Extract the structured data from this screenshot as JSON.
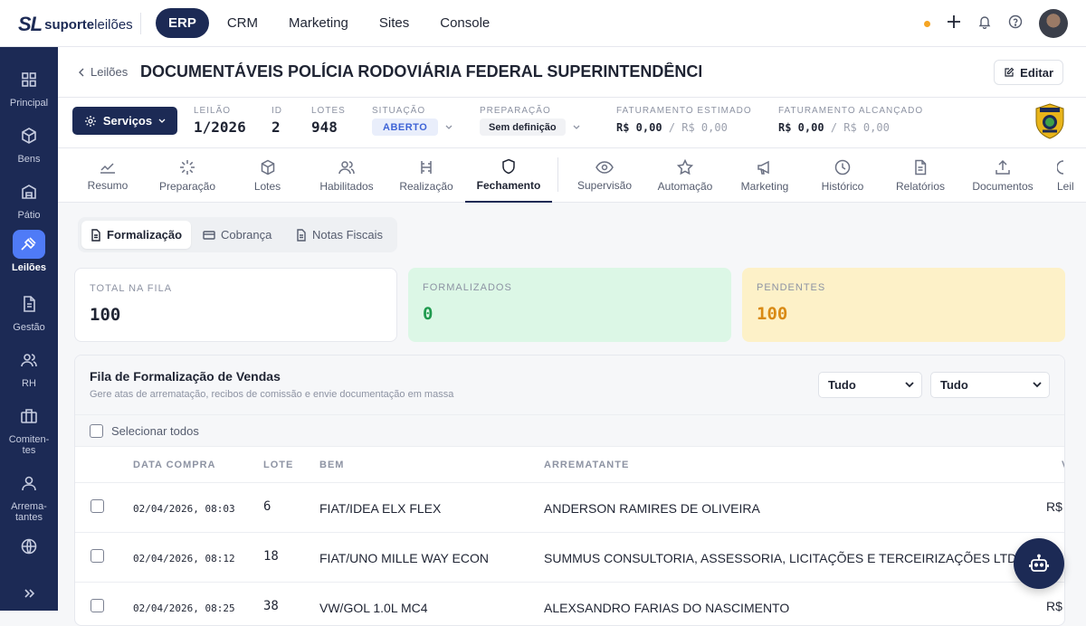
{
  "brand": {
    "mark": "SL",
    "word_bold": "suporte",
    "word_light": "leilões"
  },
  "topnav": [
    {
      "label": "ERP",
      "active": true
    },
    {
      "label": "CRM",
      "active": false
    },
    {
      "label": "Marketing",
      "active": false
    },
    {
      "label": "Sites",
      "active": false
    },
    {
      "label": "Console",
      "active": false
    }
  ],
  "sidebar": [
    {
      "label": "Principal",
      "icon": "grid-icon"
    },
    {
      "label": "Bens",
      "icon": "box-icon"
    },
    {
      "label": "Pátio",
      "icon": "warehouse-icon"
    },
    {
      "label": "Leilões",
      "icon": "gavel-icon",
      "active": true
    },
    {
      "label": "Gestão",
      "icon": "document-icon"
    },
    {
      "label": "RH",
      "icon": "users-icon"
    },
    {
      "label": "Comiten-\ntes",
      "icon": "briefcase-icon"
    },
    {
      "label": "Arrema-\ntantes",
      "icon": "user-icon"
    },
    {
      "label": "",
      "icon": "globe-icon"
    }
  ],
  "header": {
    "back_label": "Leilões",
    "title": "DOCUMENTÁVEIS POLÍCIA RODOVIÁRIA FEDERAL SUPERINTENDÊNCI...",
    "edit_label": "Editar"
  },
  "info": {
    "services_label": "Serviços",
    "leilao_label": "LEILÃO",
    "leilao_value": "1/2026",
    "id_label": "ID",
    "id_value": "2",
    "lotes_label": "LOTES",
    "lotes_value": "948",
    "situacao_label": "SITUAÇÃO",
    "situacao_value": "ABERTO",
    "preparacao_label": "PREPARAÇÃO",
    "preparacao_value": "Sem definição",
    "fat_est_label": "FATURAMENTO ESTIMADO",
    "fat_est_value": "R$ 0,00",
    "fat_est_total": "/ R$ 0,00",
    "fat_alc_label": "FATURAMENTO ALCANÇADO",
    "fat_alc_value": "R$ 0,00",
    "fat_alc_total": "/ R$ 0,00"
  },
  "tabs": [
    {
      "label": "Resumo",
      "icon": "chart-icon"
    },
    {
      "label": "Preparação",
      "icon": "loader-icon"
    },
    {
      "label": "Lotes",
      "icon": "cube-icon"
    },
    {
      "label": "Habilitados",
      "icon": "users-icon"
    },
    {
      "label": "Realização",
      "icon": "gavel-icon"
    },
    {
      "label": "Fechamento",
      "icon": "shield-icon",
      "active": true
    },
    {
      "label": "Supervisão",
      "icon": "eye-icon"
    },
    {
      "label": "Automação",
      "icon": "star-icon"
    },
    {
      "label": "Marketing",
      "icon": "megaphone-icon"
    },
    {
      "label": "Histórico",
      "icon": "clock-icon"
    },
    {
      "label": "Relatórios",
      "icon": "file-icon"
    },
    {
      "label": "Documentos",
      "icon": "upload-icon"
    },
    {
      "label": "Leil",
      "icon": "partial-icon"
    }
  ],
  "subtabs": [
    {
      "label": "Formalização",
      "active": true
    },
    {
      "label": "Cobrança"
    },
    {
      "label": "Notas Fiscais"
    }
  ],
  "stats": [
    {
      "label": "TOTAL NA FILA",
      "value": "100",
      "bg": "#ffffff",
      "color": "#1f2433"
    },
    {
      "label": "FORMALIZADOS",
      "value": "0",
      "bg": "#dcf7e6",
      "color": "#1f9a4e"
    },
    {
      "label": "PENDENTES",
      "value": "100",
      "bg": "#fdf1c8",
      "color": "#d98a14"
    }
  ],
  "queue": {
    "title": "Fila de Formalização de Vendas",
    "subtitle": "Gere atas de arrematação, recibos de comissão e envie documentação em massa",
    "filter1": "Tudo",
    "filter2": "Tudo",
    "select_all": "Selecionar todos",
    "columns": [
      "DATA COMPRA",
      "LOTE",
      "BEM",
      "ARREMATANTE",
      "V"
    ],
    "rows": [
      {
        "date": "02/04/2026, 08:03",
        "lote": "6",
        "bem": "FIAT/IDEA ELX FLEX",
        "arrematante": "ANDERSON RAMIRES DE OLIVEIRA",
        "valor": "R$"
      },
      {
        "date": "02/04/2026, 08:12",
        "lote": "18",
        "bem": "FIAT/UNO MILLE WAY ECON",
        "arrematante": "SUMMUS CONSULTORIA, ASSESSORIA, LICITAÇÕES E TERCEIRIZAÇÕES LTDA",
        "valor": ""
      },
      {
        "date": "02/04/2026, 08:25",
        "lote": "38",
        "bem": "VW/GOL 1.0L MC4",
        "arrematante": "ALEXSANDRO FARIAS DO NASCIMENTO",
        "valor": "R$"
      }
    ]
  }
}
